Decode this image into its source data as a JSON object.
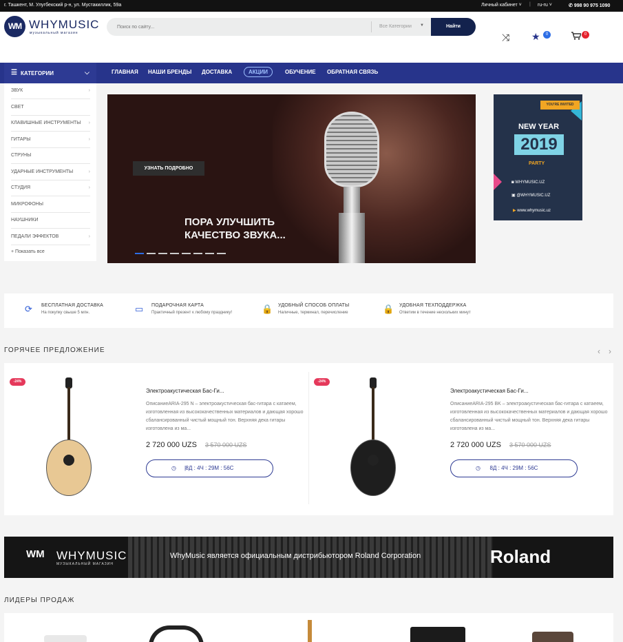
{
  "topbar": {
    "address": "г. Ташкент, М. Улугбекский р-н, ул. Мустакиллик, 59а",
    "cabinet": "Личный кабинет",
    "separator": "|",
    "language": "ru-ru",
    "phone": "998 90 975 1090"
  },
  "header": {
    "logo_mark": "WM",
    "logo_name": "WHYMUSIC",
    "logo_sub": "музыкальный магазин",
    "search_placeholder": "Поиск по сайту...",
    "search_category": "Все Категории",
    "search_button": "Найти",
    "wishlist_count": "0",
    "cart_count": "0",
    "shuffle_icon": "shuffle-icon",
    "star_icon": "star-icon",
    "cart_icon": "cart-icon"
  },
  "nav": {
    "categories_label": "КАТЕГОРИИ",
    "items": [
      "ГЛАВНАЯ",
      "НАШИ БРЕНДЫ",
      "ДОСТАВКА",
      "АКЦИИ",
      "ОБУЧЕНИЕ",
      "ОБРАТНАЯ СВЯЗЬ"
    ]
  },
  "sidebar": {
    "items": [
      {
        "label": "ЗВУК",
        "arrow": "›"
      },
      {
        "label": "СВЕТ",
        "arrow": ""
      },
      {
        "label": "КЛАВИШНЫЕ ИНСТРУМЕНТЫ",
        "arrow": "›"
      },
      {
        "label": "ГИТАРЫ",
        "arrow": "›"
      },
      {
        "label": "СТРУНЫ",
        "arrow": ""
      },
      {
        "label": "УДАРНЫЕ ИНСТРУМЕНТЫ",
        "arrow": "›"
      },
      {
        "label": "СТУДИЯ",
        "arrow": "›"
      },
      {
        "label": "МИКРОФОНЫ",
        "arrow": ""
      },
      {
        "label": "НАУШНИКИ",
        "arrow": ""
      },
      {
        "label": "ПЕДАЛИ ЭФФЕКТОВ",
        "arrow": "›"
      }
    ],
    "show_all": "+ Показать все"
  },
  "banner": {
    "button": "УЗНАТЬ ПОДРОБНО",
    "line1": "ПОРА УЛУЧШИТЬ",
    "line2": "КАЧЕСТВО ЗВУКА...",
    "slides": 8,
    "active_slide": 1
  },
  "promo": {
    "invited": "YOU'RE INVITED",
    "title": "NEW YEAR",
    "year": "2019",
    "party": "PARTY",
    "instagram": "WHYMUSIC.UZ",
    "facebook": "@WHYMUSIC.UZ",
    "site": "www.whymusic.uz"
  },
  "features": [
    {
      "icon": "sync-icon",
      "title": "БЕСПЛАТНАЯ ДОСТАВКА",
      "sub": "На покупку свыше 5 млн."
    },
    {
      "icon": "card-icon",
      "title": "ПОДАРОЧНАЯ КАРТА",
      "sub": "Практичный презент к любому празднику!"
    },
    {
      "icon": "lock-icon",
      "title": "УДОБНЫЙ СПОСОБ ОПЛАТЫ",
      "sub": "Наличные, терминал, перечисление"
    },
    {
      "icon": "lock-icon",
      "title": "УДОБНАЯ ТЕХПОДДЕРЖКА",
      "sub": "Ответим в течение нескольких минут"
    }
  ],
  "hot": {
    "title": "ГОРЯЧЕЕ ПРЕДЛОЖЕНИЕ",
    "prev": "‹",
    "next": "›",
    "products": [
      {
        "discount": "-24%",
        "name": "Электроакустическая Бас-Ги...",
        "desc": "ОписаниеARIA-295 N – электроакустическая бас-гитара с катаеем, изготовленная из высококачественных материалов и дающая хорошо сбалансированный чистый мощный тон. Верхняя дека гитары изготовлена из ма...",
        "price": "2 720 000 UZS",
        "old_price": "3 570 000 UZS",
        "timer": "8Д : 4Ч : 29М : 56С",
        "timer_sep": "|",
        "color": "#e8c894"
      },
      {
        "discount": "-24%",
        "name": "Электроакустическая Бас-Ги...",
        "desc": "ОписаниеARIA-295 BK – электроакустическая бас-гитара с катаеем, изготовленная из высококачественных материалов и дающая хорошо сбалансированный чистый мощный тон. Верхняя дека гитары изготовлена из ма...",
        "price": "2 720 000 UZS",
        "old_price": "3 570 000 UZS",
        "timer": "8Д : 4Ч : 29М : 56С",
        "timer_sep": "",
        "color": "#1e1e1e"
      }
    ]
  },
  "roland": {
    "logo_mark": "WM",
    "name": "WHYMUSIC",
    "sub": "МУЗЫКАЛЬНЫЙ МАГАЗИН",
    "text": "WhyMusic является официальным дистрибьютором Roland Corporation",
    "brand": "Roland"
  },
  "leaders": {
    "title": "ЛИДЕРЫ ПРОДАЖ"
  }
}
